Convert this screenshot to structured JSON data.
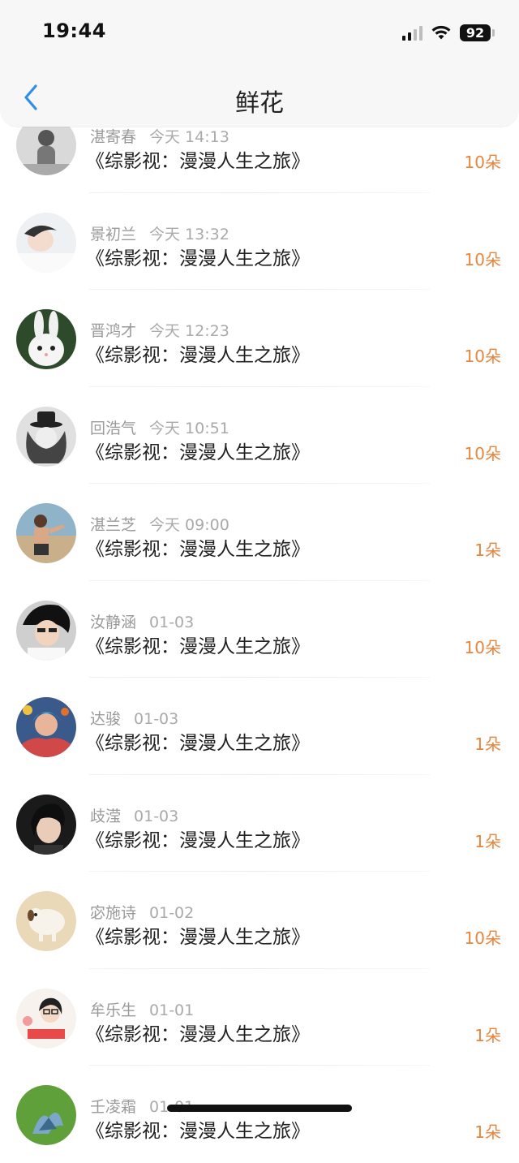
{
  "status_bar": {
    "time": "19:44",
    "battery": "92"
  },
  "nav": {
    "title": "鲜花"
  },
  "colors": {
    "accent_back": "#2f8ee8",
    "count": "#e8853d"
  },
  "items": [
    {
      "name": "湛寄春",
      "time": "今天 14:13",
      "title": "《综影视：漫漫人生之旅》",
      "count": "10朵"
    },
    {
      "name": "景初兰",
      "time": "今天 13:32",
      "title": "《综影视：漫漫人生之旅》",
      "count": "10朵"
    },
    {
      "name": "晋鸿才",
      "time": "今天 12:23",
      "title": "《综影视：漫漫人生之旅》",
      "count": "10朵"
    },
    {
      "name": "回浩气",
      "time": "今天 10:51",
      "title": "《综影视：漫漫人生之旅》",
      "count": "10朵"
    },
    {
      "name": "湛兰芝",
      "time": "今天 09:00",
      "title": "《综影视：漫漫人生之旅》",
      "count": "1朵"
    },
    {
      "name": "汝静涵",
      "time": "01-03",
      "title": "《综影视：漫漫人生之旅》",
      "count": "10朵"
    },
    {
      "name": "达骏",
      "time": "01-03",
      "title": "《综影视：漫漫人生之旅》",
      "count": "1朵"
    },
    {
      "name": "歧滢",
      "time": "01-03",
      "title": "《综影视：漫漫人生之旅》",
      "count": "1朵"
    },
    {
      "name": "宓施诗",
      "time": "01-02",
      "title": "《综影视：漫漫人生之旅》",
      "count": "10朵"
    },
    {
      "name": "牟乐生",
      "time": "01-01",
      "title": "《综影视：漫漫人生之旅》",
      "count": "1朵"
    },
    {
      "name": "壬凌霜",
      "time": "01-01",
      "title": "《综影视：漫漫人生之旅》",
      "count": "1朵"
    }
  ]
}
